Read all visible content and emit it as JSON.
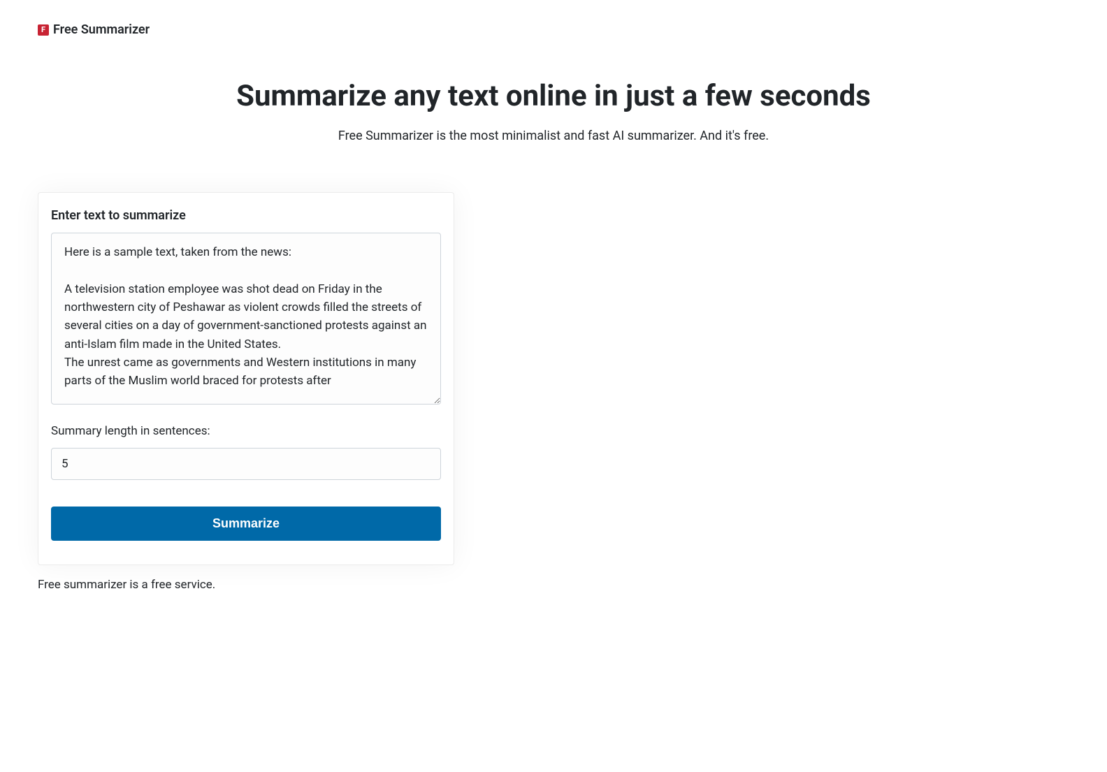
{
  "brand": {
    "icon_letter": "F",
    "name": "Free Summarizer"
  },
  "hero": {
    "title": "Summarize any text online in just a few seconds",
    "subtitle": "Free Summarizer is the most minimalist and fast AI summarizer. And it's free."
  },
  "form": {
    "card_title": "Enter text to summarize",
    "text_value": "Here is a sample text, taken from the news:\n\nA television station employee was shot dead on Friday in the northwestern city of Peshawar as violent crowds filled the streets of several cities on a day of government-sanctioned protests against an anti-Islam film made in the United States.\nThe unrest came as governments and Western institutions in many parts of the Muslim world braced for protests after",
    "length_label": "Summary length in sentences:",
    "length_value": "5",
    "submit_label": "Summarize"
  },
  "footer": {
    "text": "Free summarizer is a free service."
  }
}
